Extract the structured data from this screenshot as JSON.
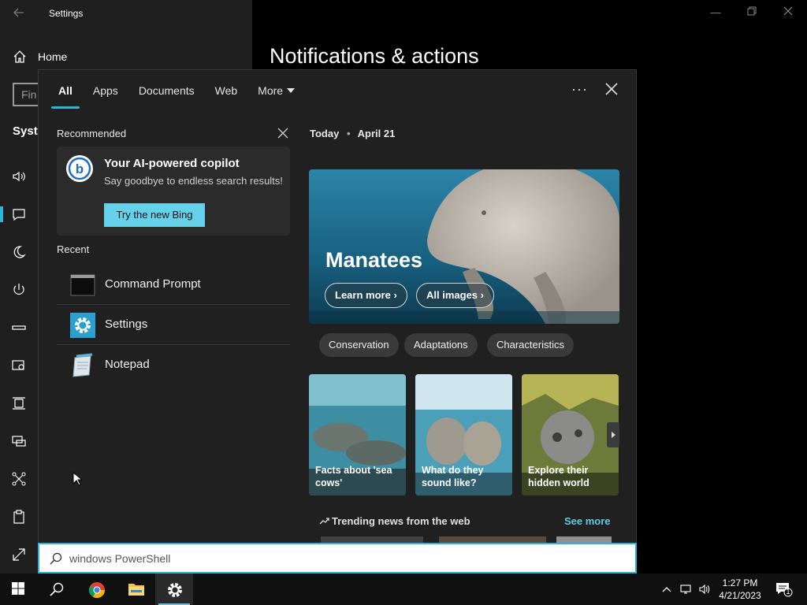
{
  "settings": {
    "window_title": "Settings",
    "home_label": "Home",
    "find_placeholder": "Fin",
    "section_label": "Syste",
    "page_title": "Notifications & actions"
  },
  "flyout": {
    "tabs": [
      "All",
      "Apps",
      "Documents",
      "Web",
      "More"
    ],
    "active_tab": "All",
    "recommended_label": "Recommended",
    "recommended": {
      "title": "Your AI-powered copilot",
      "subtitle": "Say goodbye to endless search results!",
      "button": "Try the new Bing"
    },
    "recent_label": "Recent",
    "recent": [
      {
        "label": "Command Prompt",
        "icon": "command-prompt-icon"
      },
      {
        "label": "Settings",
        "icon": "settings-gear-icon"
      },
      {
        "label": "Notepad",
        "icon": "notepad-icon"
      }
    ],
    "today": {
      "label": "Today",
      "date": "April 21"
    },
    "hero": {
      "title": "Manatees",
      "learn_more": "Learn more",
      "all_images": "All images"
    },
    "chips": [
      "Conservation",
      "Adaptations",
      "Characteristics"
    ],
    "thumbs": [
      {
        "caption": "Facts about 'sea cows'"
      },
      {
        "caption": "What do they sound like?"
      },
      {
        "caption": "Explore their hidden world"
      }
    ],
    "trending_label": "Trending news from the web",
    "see_more": "See more"
  },
  "search": {
    "value": "windows PowerShell"
  },
  "taskbar": {
    "time": "1:27 PM",
    "date": "4/21/2023",
    "notification_count": "1"
  },
  "colors": {
    "accent": "#2eb5d6",
    "bing_button": "#65d2ea",
    "flyout_bg": "#202020",
    "link": "#65c8e6"
  }
}
